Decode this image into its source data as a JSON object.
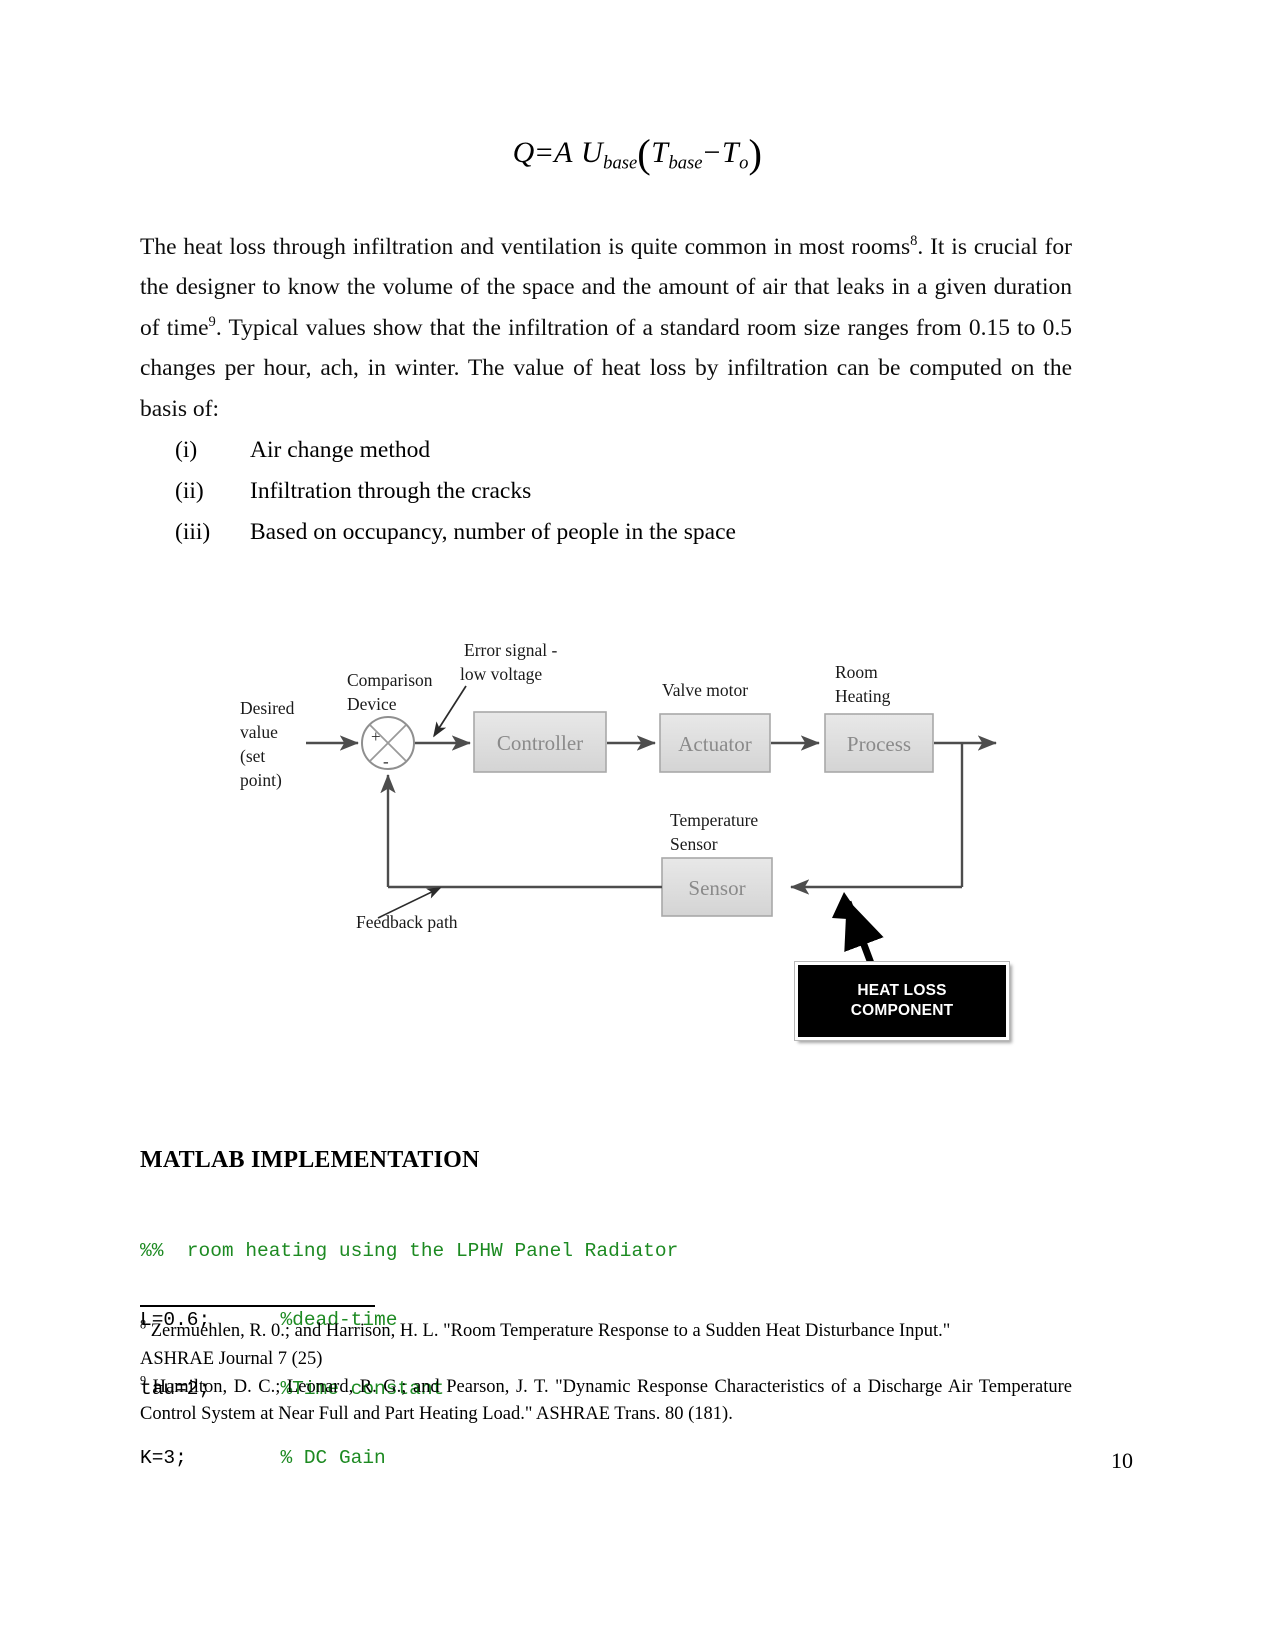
{
  "equation": {
    "lhs": "Q",
    "equals": "=",
    "a": "A",
    "u": "U",
    "u_sub": "base",
    "open_paren": "(",
    "t1": "T",
    "t1_sub": "base",
    "minus": "−",
    "t2": "T",
    "t2_sub": "o",
    "close_paren": ")",
    "plain": "Q = A U base ( T base − T o )"
  },
  "paragraph": {
    "part1": "The heat loss through infiltration and ventilation is quite common in most rooms",
    "sup1": "8",
    "part2": ". It is crucial for the designer to know the volume of the space and the amount of air that leaks in a given duration of time",
    "sup2": "9",
    "part3": ". Typical values show that the infiltration of a standard room size ranges from 0.15 to 0.5 changes per hour, ach, in winter. The value of heat loss by infiltration can be computed on the basis of:"
  },
  "list": {
    "items": [
      {
        "marker": "(i)",
        "label": "Air change method"
      },
      {
        "marker": "(ii)",
        "label": "Infiltration through the cracks"
      },
      {
        "marker": "(iii)",
        "label": "Based on occupancy, number of people in the space"
      }
    ]
  },
  "diagram": {
    "labels": {
      "desired_value": "Desired",
      "desired_value_2": "value",
      "desired_value_3": "(set",
      "desired_value_4": "point)",
      "comparison_device_1": "Comparison",
      "comparison_device_2": "Device",
      "error_signal_1": "Error signal -",
      "error_signal_2": "low voltage",
      "valve_motor": "Valve motor",
      "room_heating_1": "Room",
      "room_heating_2": "Heating",
      "temperature_sensor_1": "Temperature",
      "temperature_sensor_2": "Sensor",
      "feedback_path": "Feedback path"
    },
    "blocks": {
      "controller": "Controller",
      "actuator": "Actuator",
      "process": "Process",
      "sensor": "Sensor"
    },
    "summing_junction": {
      "plus": "+",
      "minus": "-"
    },
    "callout": {
      "line1": "HEAT LOSS",
      "line2": "COMPONENT"
    },
    "colors": {
      "block_fill": "#dedede",
      "block_border": "#9a9a9a",
      "block_text": "#8a8a8a",
      "line": "#4d4d4d",
      "callout_bg": "#000000",
      "callout_text": "#ffffff"
    }
  },
  "matlab": {
    "heading": "MATLAB IMPLEMENTATION",
    "code_lines": [
      {
        "code": "%%  room heating using the LPHW Panel Radiator",
        "comment": "",
        "type": "comment"
      },
      {
        "code": "L=0.6;",
        "pad": "      ",
        "comment": "%dead-time",
        "type": "statement"
      },
      {
        "code": "tau=2;",
        "pad": "      ",
        "comment": "%Time constant",
        "type": "statement"
      },
      {
        "code": "K=3;",
        "pad": "        ",
        "comment": "% DC Gain",
        "type": "statement"
      }
    ],
    "comment_color": "#1d8a22"
  },
  "footnotes": [
    {
      "marker": "8",
      "text_line1": "Zermuehlen, R. 0.; and Harrison, H. L. \"Room Temperature Response to a Sudden Heat Disturbance Input.\"",
      "text_line2": "ASHRAE Journal 7 (25)"
    },
    {
      "marker": "9",
      "text_line1": "Hamilton, D. C.; Leonard, R. G.; and Pearson, J. T. \"Dynamic Response Characteristics of a Discharge Air Temperature Control System at Near Full and Part Heating Load.\" ASHRAE Trans. 80 (181)."
    }
  ],
  "page_number": "10"
}
